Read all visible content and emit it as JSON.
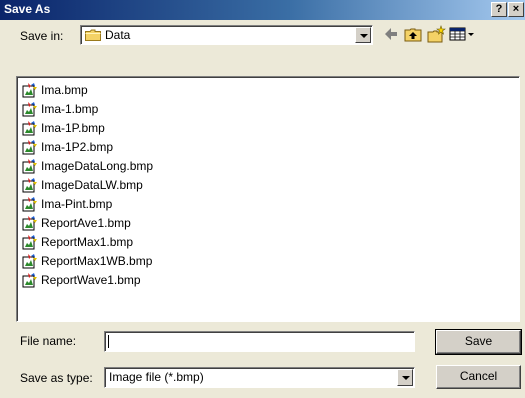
{
  "window": {
    "title": "Save As"
  },
  "title_buttons": {
    "help": "?",
    "close": "×"
  },
  "save_in": {
    "label": "Save in:",
    "value": "Data"
  },
  "toolbar": {
    "back_icon": "arrow-left-icon",
    "up_icon": "folder-up-icon",
    "new_folder_icon": "new-folder-icon",
    "view_menu_icon": "view-menu-icon"
  },
  "files": [
    "Ima.bmp",
    "Ima-1.bmp",
    "Ima-1P.bmp",
    "Ima-1P2.bmp",
    "ImageDataLong.bmp",
    "ImageDataLW.bmp",
    "Ima-Pint.bmp",
    "ReportAve1.bmp",
    "ReportMax1.bmp",
    "ReportMax1WB.bmp",
    "ReportWave1.bmp"
  ],
  "file_name": {
    "label": "File name:",
    "value": ""
  },
  "save_as_type": {
    "label": "Save as type:",
    "value": "Image file (*.bmp)"
  },
  "buttons": {
    "save": "Save",
    "cancel": "Cancel"
  },
  "colors": {
    "titlebar_start": "#0a246a",
    "titlebar_end": "#a6caf0",
    "face": "#ece9d8"
  }
}
